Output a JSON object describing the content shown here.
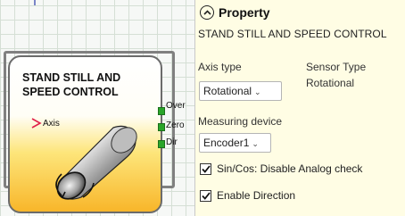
{
  "block": {
    "title_line1": "STAND STILL AND",
    "title_line2": "SPEED CONTROL",
    "input_pin": "Axis",
    "output_pins": [
      "Over",
      "Zero",
      "Dir"
    ]
  },
  "panel": {
    "title": "Property",
    "subtitle": "STAND STILL AND SPEED CONTROL",
    "axis_type_label": "Axis type",
    "axis_type_value": "Rotational",
    "sensor_type_label": "Sensor Type",
    "sensor_type_value": "Rotational",
    "measuring_device_label": "Measuring device",
    "measuring_device_value": "Encoder1",
    "checks": [
      {
        "label": "Sin/Cos: Disable Analog check",
        "checked": true
      },
      {
        "label": "Enable Direction",
        "checked": true
      }
    ]
  },
  "colors": {
    "panel_bg": "#fffde4",
    "block_gradient_bottom": "#f8b62a",
    "input_pin": "#e0204a",
    "output_pin": "#2aa52a"
  },
  "icons": [
    "chevron-up-icon",
    "chevron-down-icon",
    "checkmark-icon",
    "encoder-icon",
    "arrow-right-icon"
  ]
}
